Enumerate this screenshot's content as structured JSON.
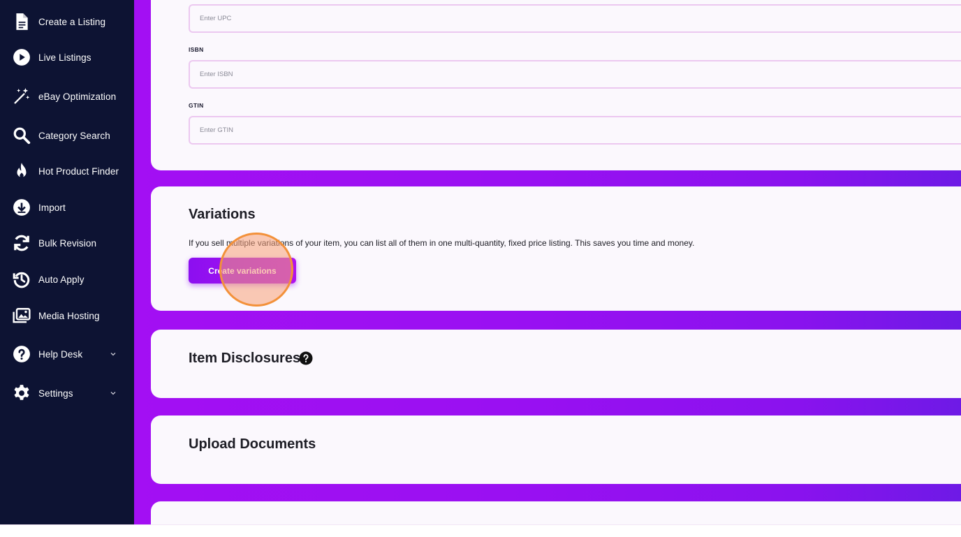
{
  "sidebar": {
    "items": [
      {
        "label": "Create a Listing",
        "icon": "document-icon"
      },
      {
        "label": "Live Listings",
        "icon": "play-circle-icon"
      },
      {
        "label": "eBay Optimization",
        "icon": "magic-wand-icon"
      },
      {
        "label": "Category Search",
        "icon": "search-icon"
      },
      {
        "label": "Hot Product Finder",
        "icon": "flame-icon"
      },
      {
        "label": "Import",
        "icon": "download-circle-icon"
      },
      {
        "label": "Bulk Revision",
        "icon": "refresh-icon"
      },
      {
        "label": "Auto Apply",
        "icon": "history-icon"
      },
      {
        "label": "Media Hosting",
        "icon": "images-icon"
      },
      {
        "label": "Help Desk",
        "icon": "help-circle-icon"
      },
      {
        "label": "Settings",
        "icon": "gear-icon"
      }
    ]
  },
  "identifiers": {
    "upc_placeholder": "Enter UPC",
    "isbn_label": "ISBN",
    "isbn_placeholder": "Enter ISBN",
    "gtin_label": "GTIN",
    "gtin_placeholder": "Enter GTIN"
  },
  "variations": {
    "title": "Variations",
    "description": "If you sell multiple variations of your item, you can list all of them in one multi-quantity, fixed price listing. This saves you time and money.",
    "button_label": "Create variations"
  },
  "item_disclosures": {
    "title": "Item Disclosures"
  },
  "upload_documents": {
    "title": "Upload Documents"
  },
  "colors": {
    "sidebar_bg": "#0d1333",
    "accent": "#9a10f2",
    "card_bg": "#fbf8fd",
    "click_marker": "#f3913a"
  }
}
